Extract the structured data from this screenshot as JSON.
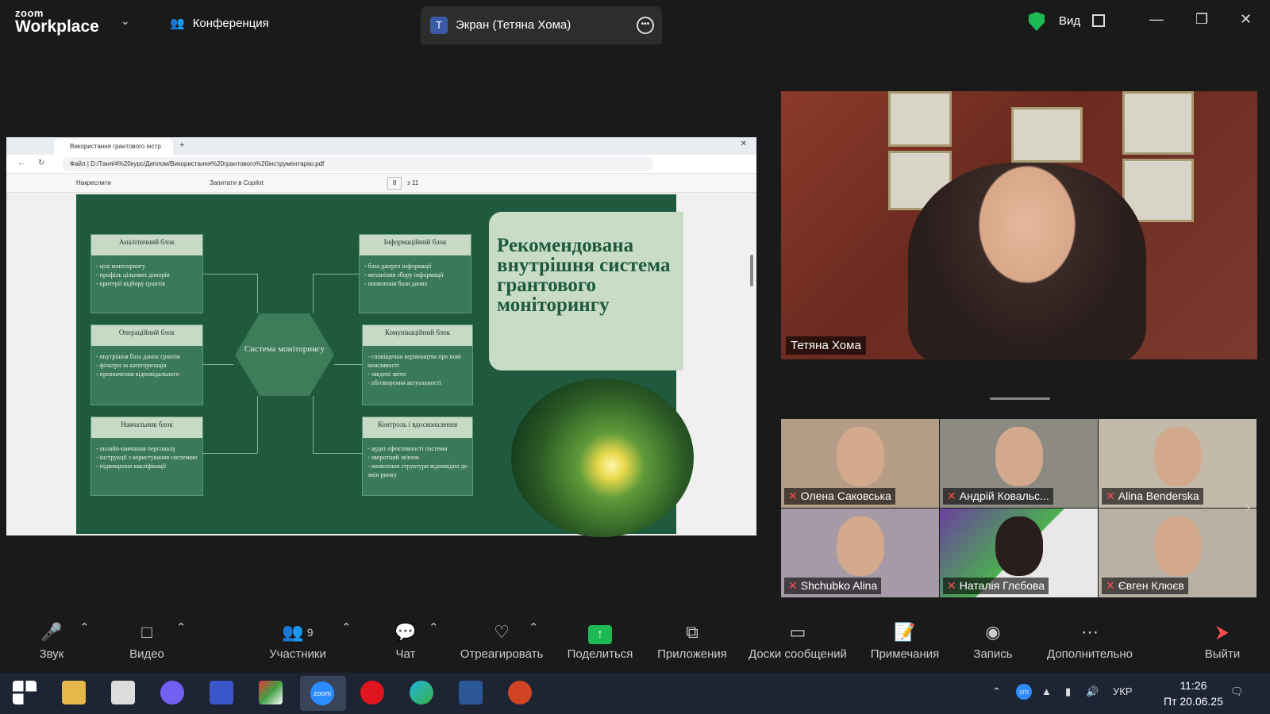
{
  "app": {
    "logo_top": "zoom",
    "logo_bottom": "Workplace",
    "conference_label": "Конференция",
    "screen_tab_initial": "T",
    "screen_tab_label": "Экран (Тетяна Хома)",
    "view_label": "Вид"
  },
  "browser": {
    "tab_title": "Використання грантового інстр",
    "file_label": "Файл",
    "address": "D:/Таня/4%20курс/Диплом/Використання%20грантового%20інструментарію.pdf",
    "draw_label": "Накреслити",
    "copilot_label": "Запитати в Copilot",
    "page_current": "8",
    "page_total": "з 11"
  },
  "slide": {
    "title": "Рекомендована внутрішня система грантового моніторингу",
    "center": "Система моніторингу",
    "blocks": [
      {
        "title": "Аналітичний блок",
        "body": "- цілі моніторингу\n- профіль цільових донорів\n- критерії відбору  грантів"
      },
      {
        "title": "Операційний блок",
        "body": "- внутрішня база даних грантів\n- фільтри за категоризація\n- призначення відповідального"
      },
      {
        "title": "Навчальник блок",
        "body": "- онлайн-навчання персоналу\n- інструкції з користування системою\n- підвищення кваліфікації"
      },
      {
        "title": "Інформаційний блок",
        "body": "- база джерел інформації\n- механізми збору інформації\n- оновлення бази даних"
      },
      {
        "title": "Комунікаційний блок",
        "body": "- сповіщення керівництва про нові можливості\n- зведені звіти\n- обговорення актуальності"
      },
      {
        "title": "Контроль і вдосконалення",
        "body": "- аудит ефективності системи\n- зворотний зв'язок\n- оновлення структури відповідно до змін ринку"
      }
    ]
  },
  "speaker": {
    "name": "Тетяна Хома"
  },
  "participants": [
    {
      "name": "Олена Саковська",
      "muted": true
    },
    {
      "name": "Андрій Ковальс...",
      "muted": true
    },
    {
      "name": "Alina Benderska",
      "muted": true
    },
    {
      "name": "Shchubko Alina",
      "muted": true
    },
    {
      "name": "Наталія Глєбова",
      "muted": true
    },
    {
      "name": "Євген Клюєв",
      "muted": true
    }
  ],
  "toolbar": {
    "audio": "Звук",
    "video": "Видео",
    "participants": "Участники",
    "participants_count": "9",
    "chat": "Чат",
    "react": "Отреагировать",
    "share": "Поделиться",
    "apps": "Приложения",
    "whiteboards": "Доски сообщений",
    "notes": "Примечания",
    "record": "Запись",
    "more": "Дополнительно",
    "leave": "Выйти"
  },
  "taskbar": {
    "lang": "УКР",
    "time": "11:26",
    "date": "Пт 20.06.25",
    "zm": "zm"
  },
  "colors": {
    "slide_bg": "#1f5a3e",
    "accent_green": "#1db954",
    "mute_red": "#ff4d4d"
  }
}
